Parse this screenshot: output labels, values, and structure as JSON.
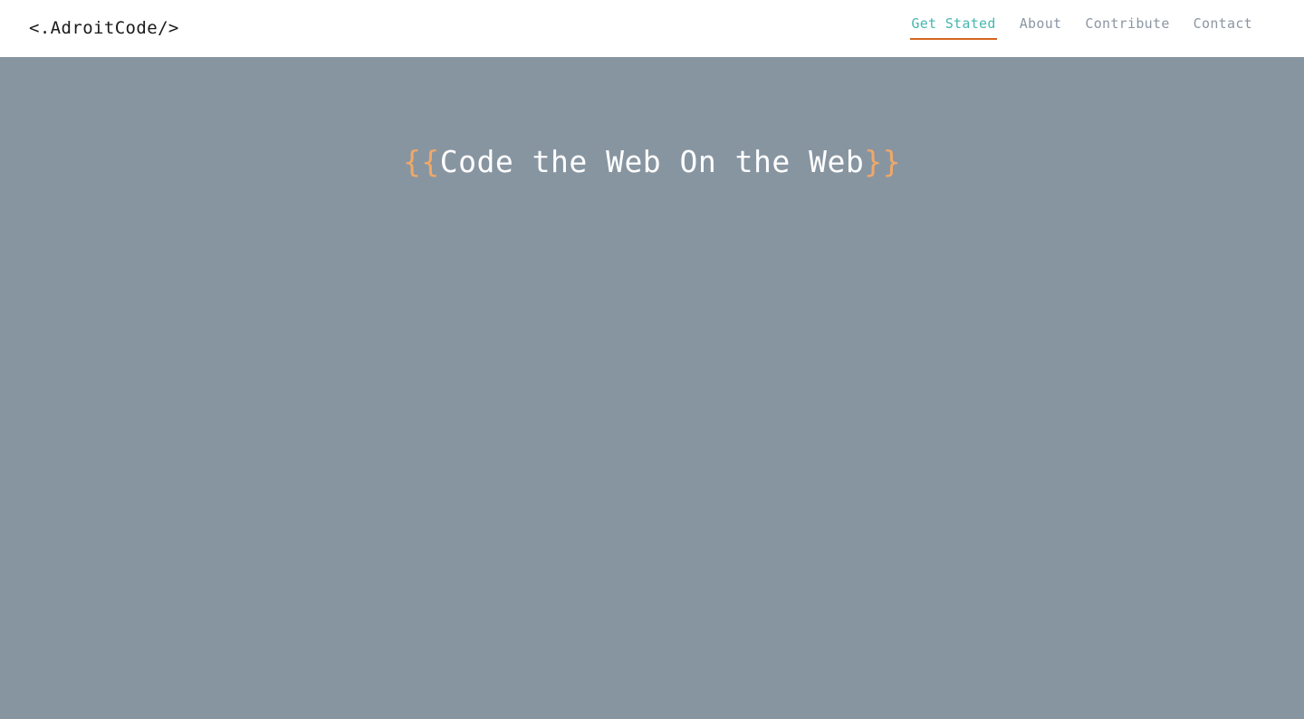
{
  "header": {
    "brand": "<.AdroitCode/>",
    "nav": [
      {
        "label": "Get Stated",
        "active": true
      },
      {
        "label": "About",
        "active": false
      },
      {
        "label": "Contribute",
        "active": false
      },
      {
        "label": "Contact",
        "active": false
      }
    ]
  },
  "hero": {
    "brace_open": "{{",
    "title": "Code the Web On the Web",
    "brace_close": "}}"
  },
  "colors": {
    "header_background": "#ffffff",
    "hero_background": "#8795a1",
    "brand_text": "#1a1a1a",
    "nav_text": "#8b96a3",
    "nav_active_text": "#45b7b0",
    "nav_active_underline": "#d4661f",
    "hero_brace": "#f0a868",
    "hero_title_text": "#ffffff"
  }
}
